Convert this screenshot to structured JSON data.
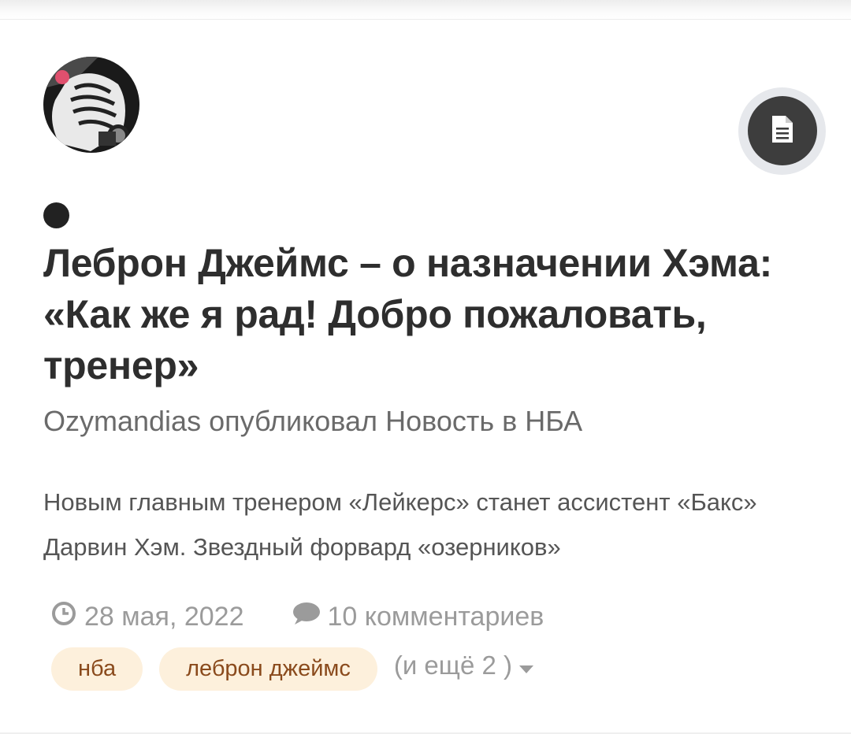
{
  "post": {
    "title": "Леброн Джеймс – о назначении Хэма: «Как же я рад! Добро пожаловать, тренер»",
    "author": "Ozymandias",
    "published_text": "опубликовал",
    "content_type": "Новость",
    "in_text": "в",
    "category": "НБА",
    "excerpt": "Новым главным тренером «Лейкерс» станет ассистент «Бакс» Дарвин Хэм. Звездный форвард «озерников»",
    "date": "28 мая, 2022",
    "comments": "10 комментариев"
  },
  "tags": {
    "items": [
      "нба",
      "леброн джеймс"
    ],
    "more_label": "(и ещё 2 )"
  },
  "icons": {
    "type_button": "document-icon",
    "date": "clock-icon",
    "comments": "comment-icon",
    "more": "caret-down-icon"
  },
  "colors": {
    "title": "#2e2e2e",
    "tag_bg": "#fdf0dc",
    "tag_text": "#8a4a1c",
    "type_button": "#3d3d3d",
    "meta_text": "#9b9b9b"
  }
}
